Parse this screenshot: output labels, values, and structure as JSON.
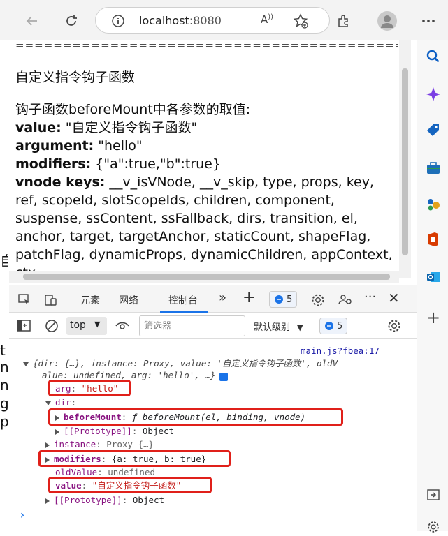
{
  "browser": {
    "url_host": "localhost",
    "url_port": ":8080"
  },
  "page": {
    "rule": "================================================================",
    "heading": "自定义指令钩子函数",
    "intro": "钩子函数beforeMount中各参数的取值:",
    "rows": [
      {
        "label": "value:",
        "value": " \"自定义指令钩子函数\""
      },
      {
        "label": "argument:",
        "value": " \"hello\""
      },
      {
        "label": "modifiers:",
        "value": " {\"a\":true,\"b\":true}"
      },
      {
        "label": "vnode keys:",
        "value": " __v_isVNode, __v_skip, type, props, key, ref, scopeId, slotScopeIds, children, component, suspense, ssContent, ssFallback, dirs, transition, el, anchor, target, targetAnchor, staticCount, shapeFlag, patchFlag, dynamicProps, dynamicChildren, appContext, ctx"
      }
    ],
    "left_strip_chars": [
      "自",
      "t",
      "n",
      "n",
      "g",
      "p"
    ]
  },
  "devtools": {
    "tabs": [
      "元素",
      "网络",
      "控制台"
    ],
    "active_tab": "控制台",
    "issues_count": "5",
    "context": "top",
    "filter_placeholder": "筛选器",
    "level": "默认级别",
    "console_count": "5"
  },
  "console": {
    "source": "main.js?fbea:17",
    "summary_line1": "{dir: {…}, instance: Proxy, value: '自定义指令钩子函数', oldV",
    "summary_line2": "alue: undefined, arg: 'hello', …}",
    "info_badge": "i",
    "props": {
      "arg_key": "arg",
      "arg_val": "\"hello\"",
      "dir_key": "dir",
      "beforeMount_key": "beforeMount",
      "beforeMount_val": "ƒ beforeMount(el, binding, vnode)",
      "proto_key": "[[Prototype]]",
      "proto_val": "Object",
      "instance_key": "instance",
      "instance_val": "Proxy {…}",
      "modifiers_key": "modifiers",
      "modifiers_val": "{a: true, b: true}",
      "oldValue_key": "oldValue",
      "oldValue_val": "undefined",
      "value_key": "value",
      "value_val": "\"自定义指令钩子函数\"",
      "proto2_key": "[[Prototype]]",
      "proto2_val": "Object"
    },
    "prompt": "›"
  },
  "colors": {
    "highlight_box": "#e0201a",
    "accent": "#1a73e8"
  }
}
